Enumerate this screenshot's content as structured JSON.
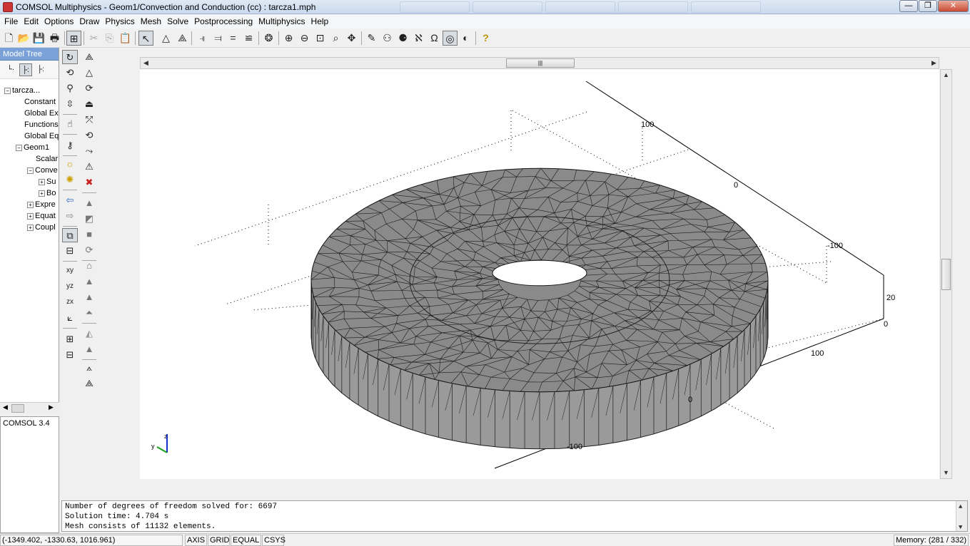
{
  "window": {
    "title": "COMSOL Multiphysics - Geom1/Convection and Conduction (cc) : tarcza1.mph",
    "minimize": "—",
    "maximize": "❐",
    "close": "✕"
  },
  "menu": [
    "File",
    "Edit",
    "Options",
    "Draw",
    "Physics",
    "Mesh",
    "Solve",
    "Postprocessing",
    "Multiphysics",
    "Help"
  ],
  "model_tree": {
    "header": "Model Tree",
    "nodes": [
      {
        "label": "tarcza...",
        "expander": "−"
      },
      {
        "label": "Constant",
        "expander": ""
      },
      {
        "label": "Global Ex",
        "expander": ""
      },
      {
        "label": "Functions",
        "expander": ""
      },
      {
        "label": "Global Eq",
        "expander": ""
      },
      {
        "label": "Geom1",
        "expander": "−"
      },
      {
        "label": "Scalar",
        "expander": ""
      },
      {
        "label": "Conve",
        "expander": "−"
      },
      {
        "label": "Su",
        "expander": "+"
      },
      {
        "label": "Bo",
        "expander": "+"
      },
      {
        "label": "Expre",
        "expander": "+"
      },
      {
        "label": "Equat",
        "expander": "+"
      },
      {
        "label": "Coupl",
        "expander": "+"
      }
    ]
  },
  "info_panel": {
    "version": "COMSOL 3.4"
  },
  "axes": {
    "x_ticks": [
      "-100",
      "0",
      "100"
    ],
    "y_ticks": [
      "100",
      "0",
      "-100"
    ],
    "z_ticks": [
      "20",
      "0"
    ],
    "triad_y": "y",
    "triad_z": "z"
  },
  "log": [
    "Number of degrees of freedom solved for: 6697",
    "Solution time: 4.704 s",
    "Mesh consists of 11132 elements."
  ],
  "status": {
    "coords": "(-1349.402, -1330.63, 1016.961)",
    "axis": "AXIS",
    "grid": "GRID",
    "equal": "EQUAL",
    "csys": "CSYS",
    "memory": "Memory: (281 / 332)"
  },
  "colors": {
    "mesh_fill": "#8a8a8a",
    "mesh_side": "#9a9a9a",
    "mesh_lines": "#1a1a1a",
    "tree_header": "#7aa2d8"
  }
}
